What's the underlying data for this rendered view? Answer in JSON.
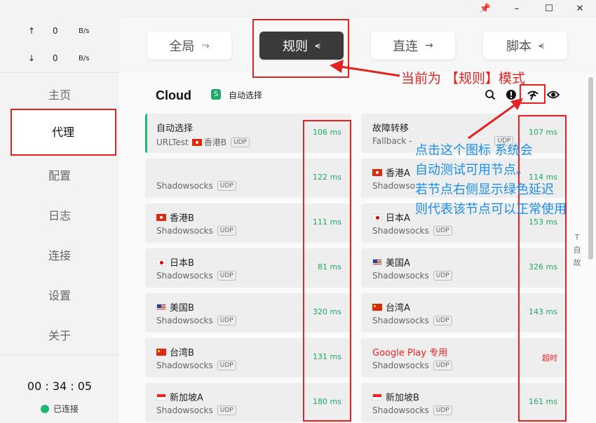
{
  "window_controls": {
    "pin": "📌",
    "minimize": "–",
    "maximize": "☐",
    "close": "✕"
  },
  "traffic": {
    "up": {
      "arrow": "↑",
      "value": "0",
      "unit": "B/s"
    },
    "down": {
      "arrow": "↓",
      "value": "0",
      "unit": "B/s"
    }
  },
  "nav": [
    {
      "label": "主页",
      "id": "home"
    },
    {
      "label": "代理",
      "id": "proxy",
      "active": true
    },
    {
      "label": "配置",
      "id": "config"
    },
    {
      "label": "日志",
      "id": "logs"
    },
    {
      "label": "连接",
      "id": "connections"
    },
    {
      "label": "设置",
      "id": "settings"
    },
    {
      "label": "关于",
      "id": "about"
    }
  ],
  "status": {
    "timer": "00 : 34 : 05",
    "connection": "已连接",
    "connected_color": "#1fba72"
  },
  "modes": [
    {
      "label": "全局",
      "icon": "⤳"
    },
    {
      "label": "规则",
      "icon": "⪪",
      "active": true
    },
    {
      "label": "直连",
      "icon": "→"
    },
    {
      "label": "脚本",
      "icon": "⪪"
    }
  ],
  "group": {
    "title": "Cloud",
    "badge": "S",
    "selected": "自动选择"
  },
  "header_icons": [
    "location-search-icon",
    "alert-icon",
    "speed-test-icon",
    "eye-icon"
  ],
  "proxies_left": [
    {
      "name": "自动选择",
      "type": "URLTest",
      "via_flag": "hk",
      "via": "香港B",
      "udp": "UDP",
      "latency": "106 ms",
      "selected": true
    },
    {
      "name": "",
      "type": "Shadowsocks",
      "udp": "UDP",
      "latency": "122 ms"
    },
    {
      "name": "香港B",
      "flag": "hk",
      "type": "Shadowsocks",
      "udp": "UDP",
      "latency": "111 ms"
    },
    {
      "name": "日本B",
      "flag": "jp",
      "type": "Shadowsocks",
      "udp": "UDP",
      "latency": "81 ms"
    },
    {
      "name": "美国B",
      "flag": "us",
      "type": "Shadowsocks",
      "udp": "UDP",
      "latency": "320 ms"
    },
    {
      "name": "台湾B",
      "flag": "cn",
      "type": "Shadowsocks",
      "udp": "UDP",
      "latency": "131 ms"
    },
    {
      "name": "新加坡A",
      "flag": "sg",
      "type": "Shadowsocks",
      "udp": "UDP",
      "latency": "180 ms"
    }
  ],
  "proxies_right": [
    {
      "name": "故障转移",
      "type": "Fallback -",
      "udp": "UDP",
      "latency": "107 ms"
    },
    {
      "name": "香港A",
      "flag": "hk",
      "type": "Shadowso",
      "udp": "",
      "latency": "114 ms"
    },
    {
      "name": "日本A",
      "flag": "jp",
      "type": "Shadowsocks",
      "udp": "UDP",
      "latency": "153 ms"
    },
    {
      "name": "美国A",
      "flag": "us",
      "type": "Shadowsocks",
      "udp": "UDP",
      "latency": "326 ms"
    },
    {
      "name": "台湾A",
      "flag": "cn",
      "type": "Shadowsocks",
      "udp": "UDP",
      "latency": "143 ms"
    },
    {
      "name": "Google Play 专用",
      "type": "Shadowsocks",
      "udp": "UDP",
      "latency": "超时",
      "timeout": true
    },
    {
      "name": "新加坡B",
      "flag": "sg",
      "type": "Shadowsocks",
      "udp": "UDP",
      "latency": "161 ms"
    }
  ],
  "side_label": [
    "T",
    "自",
    "故"
  ],
  "annotations": {
    "mode_note": "当前为 【规则】模式",
    "test_note": [
      "点击这个图标 系统会",
      "自动测试可用节点。",
      "若节点右侧显示绿色延迟",
      "则代表该节点可以正常使用"
    ],
    "color": "#e42222",
    "blue": "#1d8ee8"
  }
}
